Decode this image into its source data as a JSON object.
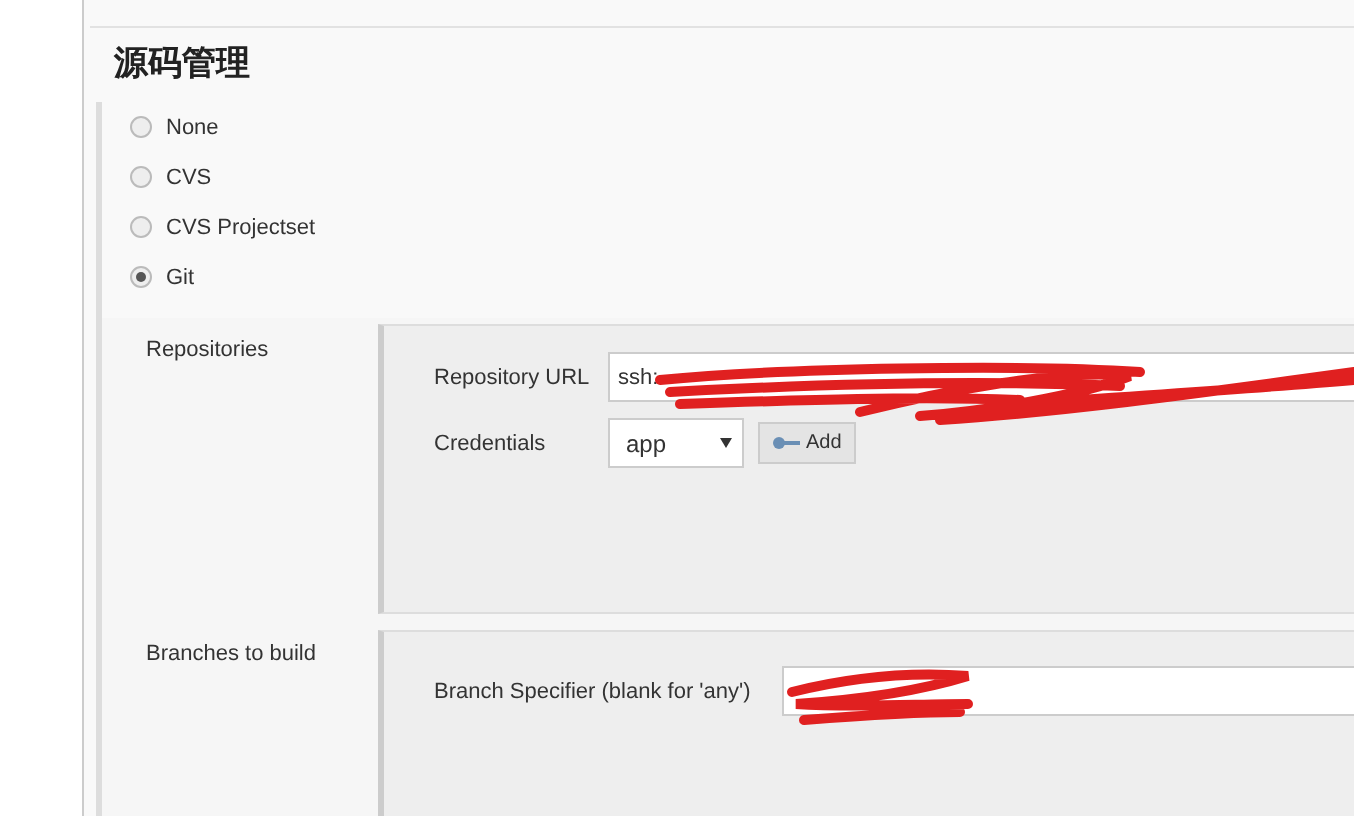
{
  "section_title": "源码管理",
  "scm_options": [
    {
      "label": "None",
      "selected": false
    },
    {
      "label": "CVS",
      "selected": false
    },
    {
      "label": "CVS Projectset",
      "selected": false
    },
    {
      "label": "Git",
      "selected": true
    }
  ],
  "repositories": {
    "label": "Repositories",
    "url_label": "Repository URL",
    "url_value": "ssh:",
    "credentials_label": "Credentials",
    "credentials_value": "app",
    "add_button": "Add"
  },
  "branches": {
    "label": "Branches to build",
    "specifier_label": "Branch Specifier (blank for 'any')"
  }
}
